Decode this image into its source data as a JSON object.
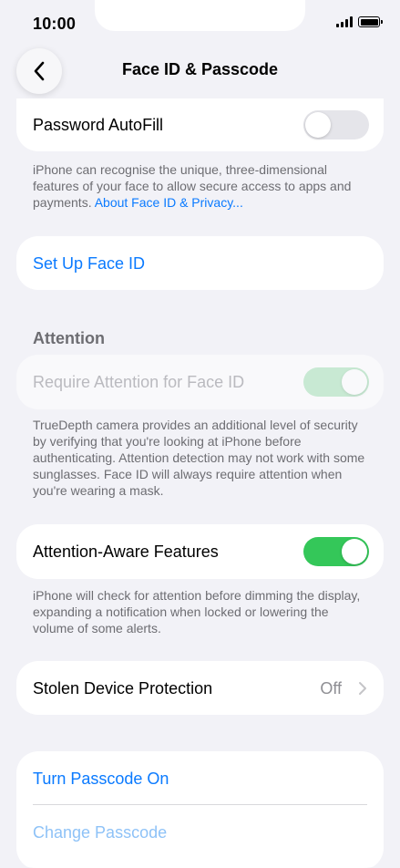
{
  "status_bar": {
    "time": "10:00"
  },
  "nav": {
    "title": "Face ID & Passcode"
  },
  "password_autofill": {
    "label": "Password AutoFill",
    "enabled": false
  },
  "face_id_footer": {
    "text": "iPhone can recognise the unique, three-dimensional features of your face to allow secure access to apps and payments. ",
    "link": "About Face ID & Privacy..."
  },
  "set_up_face_id": {
    "label": "Set Up Face ID"
  },
  "attention_section": {
    "header": "Attention"
  },
  "require_attention": {
    "label": "Require Attention for Face ID",
    "enabled": true,
    "disabled": true
  },
  "require_attention_footer": {
    "text": "TrueDepth camera provides an additional level of security by verifying that you're looking at iPhone before authenticating. Attention detection may not work with some sunglasses. Face ID will always require attention when you're wearing a mask."
  },
  "attention_aware": {
    "label": "Attention-Aware Features",
    "enabled": true
  },
  "attention_aware_footer": {
    "text": "iPhone will check for attention before dimming the display, expanding a notification when locked or lowering the volume of some alerts."
  },
  "stolen_device": {
    "label": "Stolen Device Protection",
    "value": "Off"
  },
  "passcode": {
    "turn_on_label": "Turn Passcode On",
    "change_label": "Change Passcode"
  },
  "colors": {
    "accent_blue": "#0a7aff",
    "toggle_green": "#34c759",
    "toggle_off": "#e5e5ea"
  }
}
